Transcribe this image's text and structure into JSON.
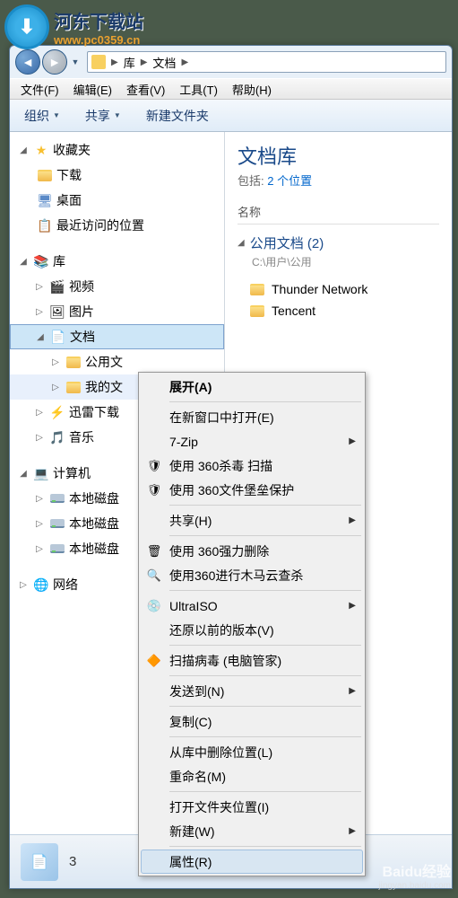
{
  "watermark": {
    "title": "河东下载站",
    "url": "www.pc0359.cn"
  },
  "breadcrumb": {
    "seg1": "库",
    "seg2": "文档"
  },
  "menubar": [
    "文件(F)",
    "编辑(E)",
    "查看(V)",
    "工具(T)",
    "帮助(H)"
  ],
  "toolbar": {
    "organize": "组织",
    "share": "共享",
    "newfolder": "新建文件夹"
  },
  "tree": {
    "favorites": "收藏夹",
    "downloads": "下载",
    "desktop": "桌面",
    "recent": "最近访问的位置",
    "libraries": "库",
    "videos": "视频",
    "pictures": "图片",
    "documents": "文档",
    "public_docs": "公用文",
    "my_docs": "我的文",
    "thunder": "迅雷下载",
    "music": "音乐",
    "computer": "计算机",
    "drive1": "本地磁盘",
    "drive2": "本地磁盘",
    "drive3": "本地磁盘",
    "network": "网络"
  },
  "main": {
    "lib_title": "文档库",
    "lib_sub_prefix": "包括: ",
    "lib_sub_link": "2 个位置",
    "col_name": "名称",
    "group_title": "公用文档 (2)",
    "group_path": "C:\\用户\\公用",
    "files": [
      "Thunder Network",
      "Tencent"
    ]
  },
  "context_menu": {
    "expand": "展开(A)",
    "open_new": "在新窗口中打开(E)",
    "sevenzip": "7-Zip",
    "scan360": "使用 360杀毒 扫描",
    "fortress360": "使用 360文件堡垒保护",
    "share": "共享(H)",
    "force_del": "使用 360强力删除",
    "trojan": "使用360进行木马云查杀",
    "ultraiso": "UltraISO",
    "restore": "还原以前的版本(V)",
    "scan_virus": "扫描病毒 (电脑管家)",
    "sendto": "发送到(N)",
    "copy": "复制(C)",
    "remove_lib": "从库中删除位置(L)",
    "rename": "重命名(M)",
    "open_loc": "打开文件夹位置(I)",
    "new": "新建(W)",
    "properties": "属性(R)"
  },
  "status": {
    "count": "3"
  },
  "baidu": {
    "main": "Baidu经验",
    "sub": "jingyan.baidu.com"
  }
}
